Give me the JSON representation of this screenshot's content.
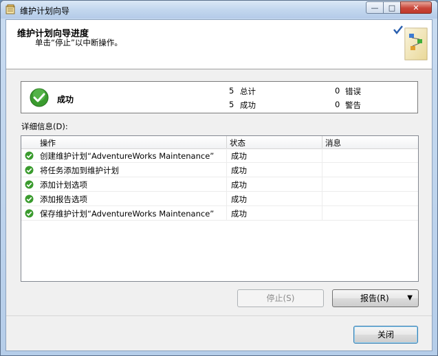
{
  "window": {
    "title": "维护计划向导"
  },
  "header": {
    "title": "维护计划向导进度",
    "subtitle": "单击“停止”以中断操作。"
  },
  "summary": {
    "status": "成功",
    "total_count": "5",
    "total_label": "总计",
    "success_count": "5",
    "success_label": "成功",
    "error_count": "0",
    "error_label": "错误",
    "warning_count": "0",
    "warning_label": "警告"
  },
  "details": {
    "label": "详细信息(D):",
    "columns": [
      "操作",
      "状态",
      "消息"
    ],
    "rows": [
      {
        "operation": "创建维护计划“AdventureWorks Maintenance”",
        "status": "成功",
        "message": ""
      },
      {
        "operation": "将任务添加到维护计划",
        "status": "成功",
        "message": ""
      },
      {
        "operation": "添加计划选项",
        "status": "成功",
        "message": ""
      },
      {
        "operation": "添加报告选项",
        "status": "成功",
        "message": ""
      },
      {
        "operation": "保存维护计划“AdventureWorks Maintenance”",
        "status": "成功",
        "message": ""
      }
    ]
  },
  "buttons": {
    "stop": "停止(S)",
    "report": "报告(R)",
    "close": "关闭"
  },
  "colors": {
    "success_green": "#3a9b2e",
    "title_bar": "#c3d7ee"
  }
}
